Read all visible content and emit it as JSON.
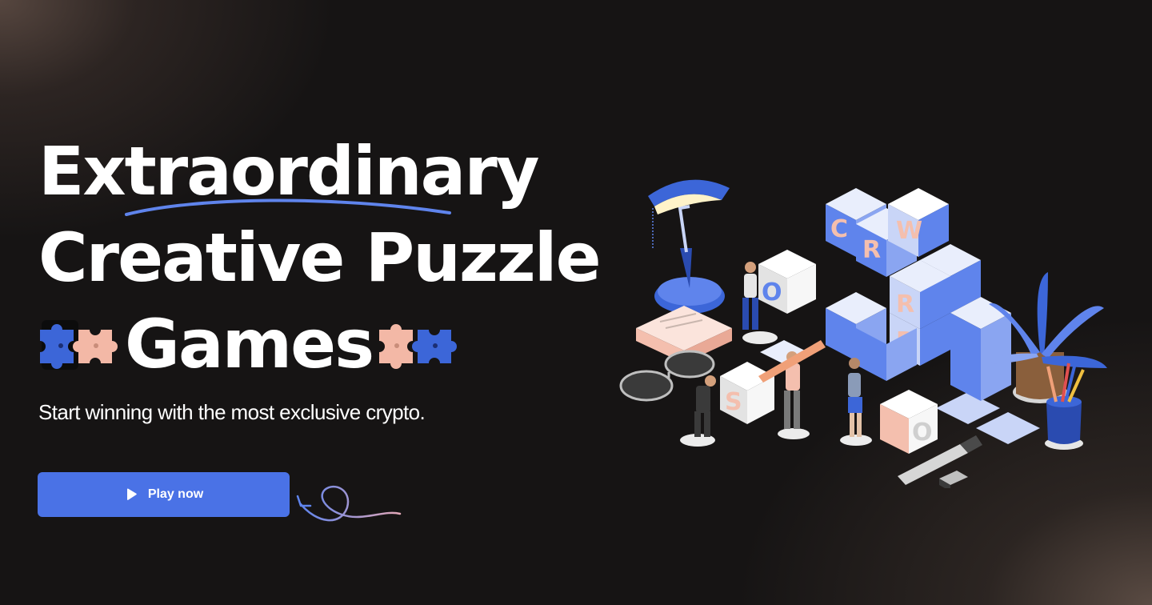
{
  "hero": {
    "headline": {
      "line1": "Extraordinary",
      "line2": "Creative Puzzle",
      "line3": "Games"
    },
    "subtitle": "Start winning with the most exclusive crypto.",
    "cta": {
      "label": "Play now",
      "icon": "play-icon"
    }
  },
  "illustration": {
    "cube_letters": [
      "C",
      "R",
      "W",
      "S",
      "R",
      "D",
      "O",
      "S",
      "O"
    ]
  },
  "colors": {
    "background": "#161414",
    "accent_blue": "#4a72e6",
    "puzzle_blue": "#3c66d8",
    "puzzle_pink": "#f3b8a6",
    "cube_light": "#c9d5f7",
    "cube_blue": "#5f84ec",
    "cube_pink": "#f4bfae"
  }
}
